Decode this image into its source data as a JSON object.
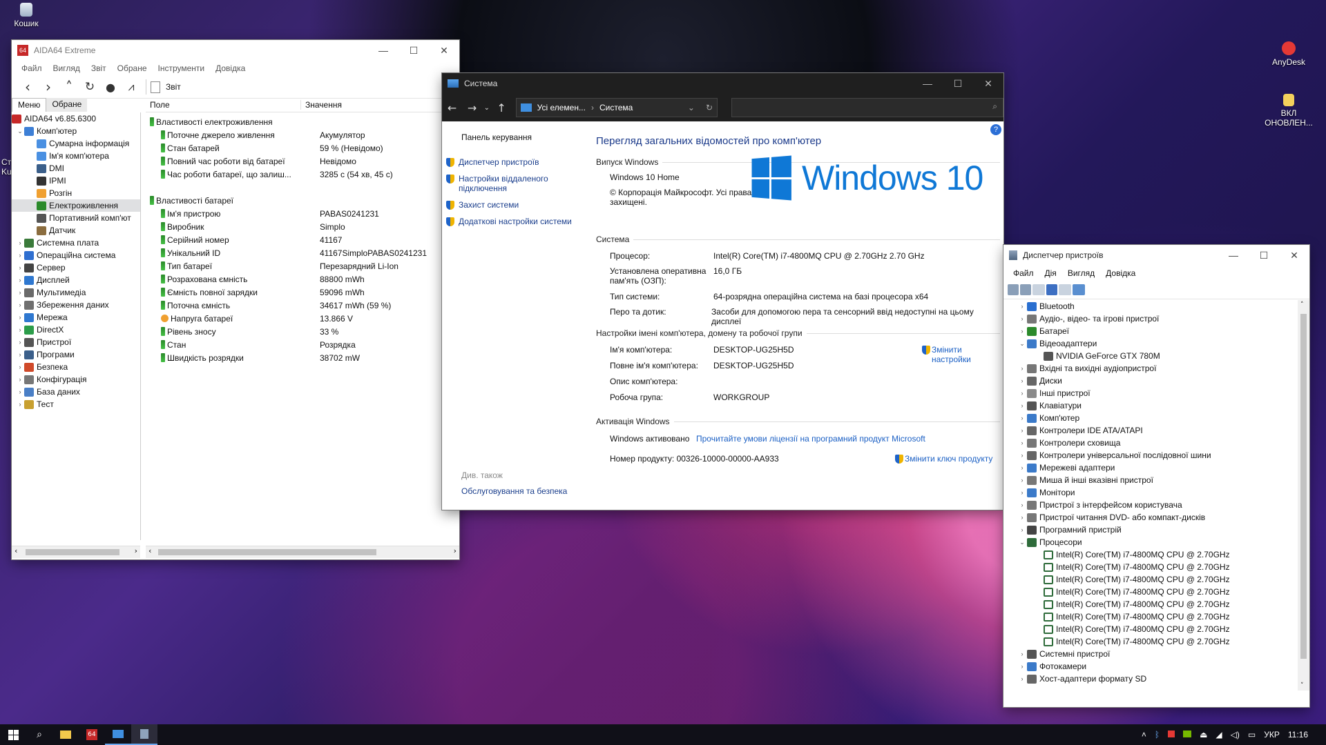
{
  "desktop": {
    "icons": [
      {
        "label": "Кошик"
      },
      {
        "label": "AnyDesk"
      },
      {
        "label": "ВКЛ ОНОВЛЕН..."
      }
    ],
    "edge_fragments": [
      "Ст",
      "Ku"
    ]
  },
  "aida": {
    "title": "AIDA64 Extreme",
    "menu": [
      "Файл",
      "Вигляд",
      "Звіт",
      "Обране",
      "Інструменти",
      "Довідка"
    ],
    "toolbar_report": "Звіт",
    "tabs": [
      "Меню",
      "Обране"
    ],
    "version": "AIDA64 v6.85.6300",
    "tree": [
      {
        "label": "Комп'ютер",
        "level": 1,
        "expander": "v"
      },
      {
        "label": "Сумарна інформація",
        "level": 2,
        "expander": ""
      },
      {
        "label": "Ім'я комп'ютера",
        "level": 2,
        "expander": ""
      },
      {
        "label": "DMI",
        "level": 2,
        "expander": ""
      },
      {
        "label": "IPMI",
        "level": 2,
        "expander": ""
      },
      {
        "label": "Розгін",
        "level": 2,
        "expander": ""
      },
      {
        "label": "Електроживлення",
        "level": 2,
        "expander": "",
        "selected": true
      },
      {
        "label": "Портативний комп'ют",
        "level": 2,
        "expander": ""
      },
      {
        "label": "Датчик",
        "level": 2,
        "expander": ""
      },
      {
        "label": "Системна плата",
        "level": 1,
        "expander": ">"
      },
      {
        "label": "Операційна система",
        "level": 1,
        "expander": ">"
      },
      {
        "label": "Сервер",
        "level": 1,
        "expander": ">"
      },
      {
        "label": "Дисплей",
        "level": 1,
        "expander": ">"
      },
      {
        "label": "Мультимедіа",
        "level": 1,
        "expander": ">"
      },
      {
        "label": "Збереження даних",
        "level": 1,
        "expander": ">"
      },
      {
        "label": "Мережа",
        "level": 1,
        "expander": ">"
      },
      {
        "label": "DirectX",
        "level": 1,
        "expander": ">"
      },
      {
        "label": "Пристрої",
        "level": 1,
        "expander": ">"
      },
      {
        "label": "Програми",
        "level": 1,
        "expander": ">"
      },
      {
        "label": "Безпека",
        "level": 1,
        "expander": ">"
      },
      {
        "label": "Конфігурація",
        "level": 1,
        "expander": ">"
      },
      {
        "label": "База даних",
        "level": 1,
        "expander": ">"
      },
      {
        "label": "Тест",
        "level": 1,
        "expander": ">"
      }
    ],
    "columns": [
      "Поле",
      "Значення"
    ],
    "groups": [
      {
        "title": "Властивості електроживлення",
        "rows": [
          {
            "field": "Поточне джерело живлення",
            "value": "Акумулятор"
          },
          {
            "field": "Стан батарей",
            "value": "59 % (Невідомо)"
          },
          {
            "field": "Повний час роботи від батареї",
            "value": "Невідомо"
          },
          {
            "field": "Час роботи батареї, що залиш...",
            "value": "3285 с (54 хв, 45 с)"
          }
        ]
      },
      {
        "title": "Властивості батареї",
        "rows": [
          {
            "field": "Ім'я пристрою",
            "value": "PABAS0241231"
          },
          {
            "field": "Виробник",
            "value": "Simplo"
          },
          {
            "field": "Серійний номер",
            "value": "41167"
          },
          {
            "field": "Унікальний ID",
            "value": "41167SimploPABAS0241231"
          },
          {
            "field": "Тип батареї",
            "value": "Перезарядний Li-Ion"
          },
          {
            "field": "Розрахована ємність",
            "value": "88800 mWh"
          },
          {
            "field": "Ємність повної зарядки",
            "value": "59096 mWh"
          },
          {
            "field": "Поточна ємність",
            "value": "34617 mWh  (59 %)"
          },
          {
            "field": "Напруга батареї",
            "value": "13.866 V"
          },
          {
            "field": "Рівень зносу",
            "value": "33 %"
          },
          {
            "field": "Стан",
            "value": "Розрядка"
          },
          {
            "field": "Швидкість розрядки",
            "value": "38702 mW"
          }
        ]
      }
    ]
  },
  "system": {
    "title": "Система",
    "breadcrumb": [
      "Усі елемен...",
      "Система"
    ],
    "left_title": "Панель керування",
    "left_links": [
      "Диспетчер пристроїв",
      "Настройки віддаленого підключення",
      "Захист системи",
      "Додаткові настройки системи"
    ],
    "see_also": "Див. також",
    "see_also_link": "Обслуговування та безпека",
    "heading": "Перегляд загальних відомостей про комп'ютер",
    "edition_section": "Випуск Windows",
    "edition": "Windows 10 Home",
    "copyright": "© Корпорація Майкрософт. Усі права захищені.",
    "logo_text": "Windows 10",
    "system_section": "Система",
    "system_rows": [
      {
        "k": "Процесор:",
        "v": "Intel(R) Core(TM) i7-4800MQ CPU @ 2.70GHz   2.70 GHz"
      },
      {
        "k": "Установлена оперативна пам'ять (ОЗП):",
        "v": "16,0 ГБ"
      },
      {
        "k": "Тип системи:",
        "v": "64-розрядна операційна система на базі процесора x64"
      },
      {
        "k": "Перо та дотик:",
        "v": "Засоби для допомогою пера та сенсорний ввід недоступні на цьому дисплеї"
      }
    ],
    "name_section": "Настройки імені комп'ютера, домену та робочої групи",
    "name_rows": [
      {
        "k": "Ім'я комп'ютера:",
        "v": "DESKTOP-UG25H5D"
      },
      {
        "k": "Повне ім'я комп'ютера:",
        "v": "DESKTOP-UG25H5D"
      },
      {
        "k": "Опис комп'ютера:",
        "v": ""
      },
      {
        "k": "Робоча група:",
        "v": "WORKGROUP"
      }
    ],
    "change_settings": "Змінити настройки",
    "activation_section": "Активація Windows",
    "activated": "Windows активовано",
    "license_link": "Прочитайте умови ліцензії на програмний продукт Microsoft",
    "product_id_label": "Номер продукту:",
    "product_id": "00326-10000-00000-AA933",
    "change_key": "Змінити ключ продукту",
    "help": "?"
  },
  "devmgr": {
    "title": "Диспетчер пристроїв",
    "menu": [
      "Файл",
      "Дія",
      "Вигляд",
      "Довідка"
    ],
    "tree": [
      {
        "label": "Bluetooth",
        "expander": ">",
        "level": 1
      },
      {
        "label": "Аудіо-, відео- та ігрові пристрої",
        "expander": ">",
        "level": 1
      },
      {
        "label": "Батареї",
        "expander": ">",
        "level": 1
      },
      {
        "label": "Відеоадаптери",
        "expander": "v",
        "level": 1
      },
      {
        "label": "NVIDIA GeForce GTX 780M",
        "expander": "",
        "level": 2
      },
      {
        "label": "Вхідні та вихідні аудіопристрої",
        "expander": ">",
        "level": 1
      },
      {
        "label": "Диски",
        "expander": ">",
        "level": 1
      },
      {
        "label": "Інші пристрої",
        "expander": ">",
        "level": 1
      },
      {
        "label": "Клавіатури",
        "expander": ">",
        "level": 1
      },
      {
        "label": "Комп'ютер",
        "expander": ">",
        "level": 1
      },
      {
        "label": "Контролери IDE ATA/ATAPI",
        "expander": ">",
        "level": 1
      },
      {
        "label": "Контролери сховища",
        "expander": ">",
        "level": 1
      },
      {
        "label": "Контролери універсальної послідовної шини",
        "expander": ">",
        "level": 1
      },
      {
        "label": "Мережеві адаптери",
        "expander": ">",
        "level": 1
      },
      {
        "label": "Миша й інші вказівні пристрої",
        "expander": ">",
        "level": 1
      },
      {
        "label": "Монітори",
        "expander": ">",
        "level": 1
      },
      {
        "label": "Пристрої з інтерфейсом користувача",
        "expander": ">",
        "level": 1
      },
      {
        "label": "Пристрої читання DVD- або компакт-дисків",
        "expander": ">",
        "level": 1
      },
      {
        "label": "Програмний пристрій",
        "expander": ">",
        "level": 1
      },
      {
        "label": "Процесори",
        "expander": "v",
        "level": 1
      },
      {
        "label": "Intel(R) Core(TM) i7-4800MQ CPU @ 2.70GHz",
        "expander": "",
        "level": 2
      },
      {
        "label": "Intel(R) Core(TM) i7-4800MQ CPU @ 2.70GHz",
        "expander": "",
        "level": 2
      },
      {
        "label": "Intel(R) Core(TM) i7-4800MQ CPU @ 2.70GHz",
        "expander": "",
        "level": 2
      },
      {
        "label": "Intel(R) Core(TM) i7-4800MQ CPU @ 2.70GHz",
        "expander": "",
        "level": 2
      },
      {
        "label": "Intel(R) Core(TM) i7-4800MQ CPU @ 2.70GHz",
        "expander": "",
        "level": 2
      },
      {
        "label": "Intel(R) Core(TM) i7-4800MQ CPU @ 2.70GHz",
        "expander": "",
        "level": 2
      },
      {
        "label": "Intel(R) Core(TM) i7-4800MQ CPU @ 2.70GHz",
        "expander": "",
        "level": 2
      },
      {
        "label": "Intel(R) Core(TM) i7-4800MQ CPU @ 2.70GHz",
        "expander": "",
        "level": 2
      },
      {
        "label": "Системні пристрої",
        "expander": ">",
        "level": 1
      },
      {
        "label": "Фотокамери",
        "expander": ">",
        "level": 1
      },
      {
        "label": "Хост-адаптери формату SD",
        "expander": ">",
        "level": 1
      }
    ]
  },
  "taskbar": {
    "lang": "УКР",
    "time": "11:16"
  }
}
